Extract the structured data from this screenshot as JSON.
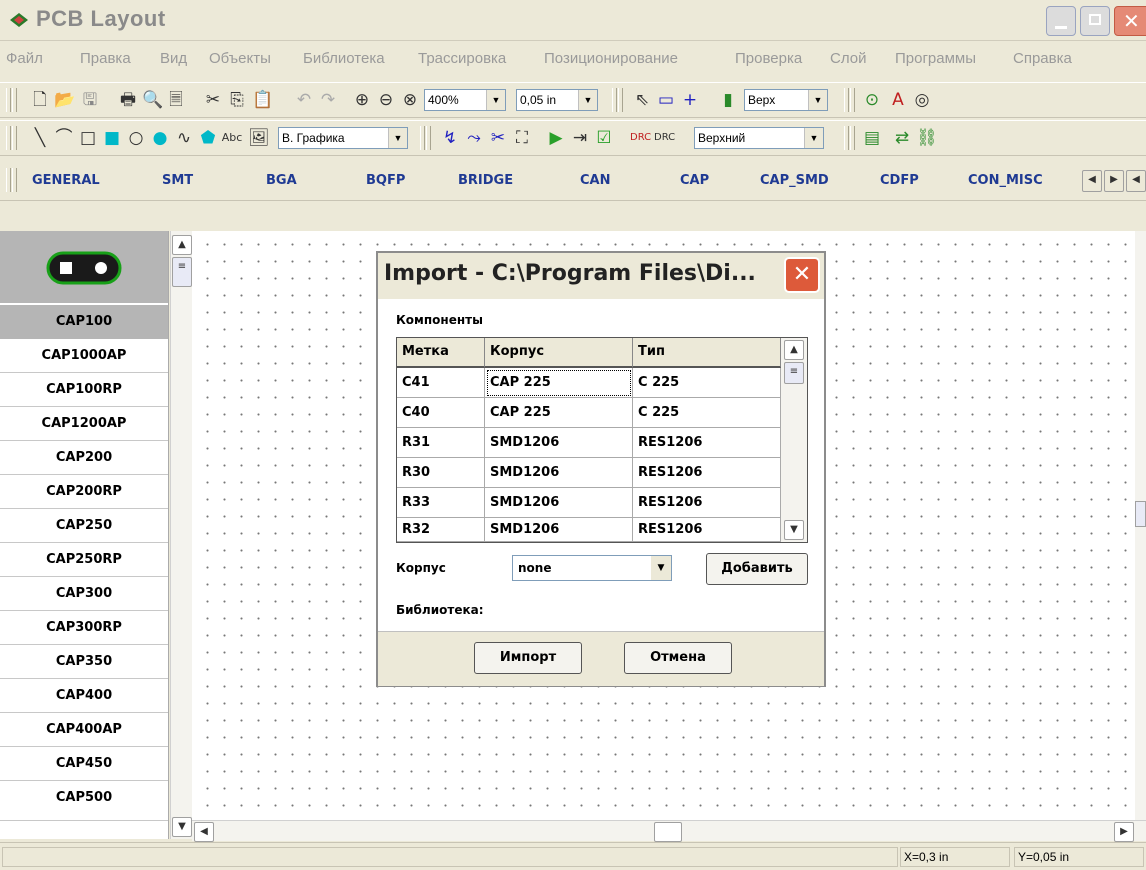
{
  "window": {
    "title": "PCB Layout"
  },
  "menu": [
    "Файл",
    "Правка",
    "Вид",
    "Объекты",
    "Библиотека",
    "Трассировка",
    "Позиционирование",
    "Проверка",
    "Слой",
    "Программы",
    "Справка"
  ],
  "toolbar1": {
    "zoom": "400%",
    "grid_step": "0,05 in",
    "layer": "Верх"
  },
  "toolbar2": {
    "text_tool": "Abc",
    "graphics_layer": "В. Графика",
    "copper_layer": "Верхний"
  },
  "library_tabs": [
    "GENERAL",
    "SMT",
    "BGA",
    "BQFP",
    "BRIDGE",
    "CAN",
    "CAP",
    "CAP_SMD",
    "CDFP",
    "CON_MISC"
  ],
  "components": {
    "selected": "CAP100",
    "items": [
      "CAP1000AP",
      "CAP100RP",
      "CAP1200AP",
      "CAP200",
      "CAP200RP",
      "CAP250",
      "CAP250RP",
      "CAP300",
      "CAP300RP",
      "CAP350",
      "CAP400",
      "CAP400AP",
      "CAP450",
      "CAP500"
    ]
  },
  "status": {
    "x": "X=0,3 in",
    "y": "Y=0,05 in"
  },
  "dialog": {
    "title": "Import - C:\\Program Files\\Di...",
    "components_label": "Компоненты",
    "columns": [
      "Метка",
      "Корпус",
      "Тип"
    ],
    "rows": [
      [
        "C41",
        "CAP 225",
        "C 225"
      ],
      [
        "C40",
        "CAP 225",
        "C 225"
      ],
      [
        "R31",
        "SMD1206",
        "RES1206"
      ],
      [
        "R30",
        "SMD1206",
        "RES1206"
      ],
      [
        "R33",
        "SMD1206",
        "RES1206"
      ],
      [
        "R32",
        "SMD1206",
        "RES1206"
      ]
    ],
    "package_label": "Корпус",
    "package_value": "none",
    "add_button": "Добавить",
    "library_label": "Библиотека:",
    "import_button": "Импорт",
    "cancel_button": "Отмена"
  }
}
